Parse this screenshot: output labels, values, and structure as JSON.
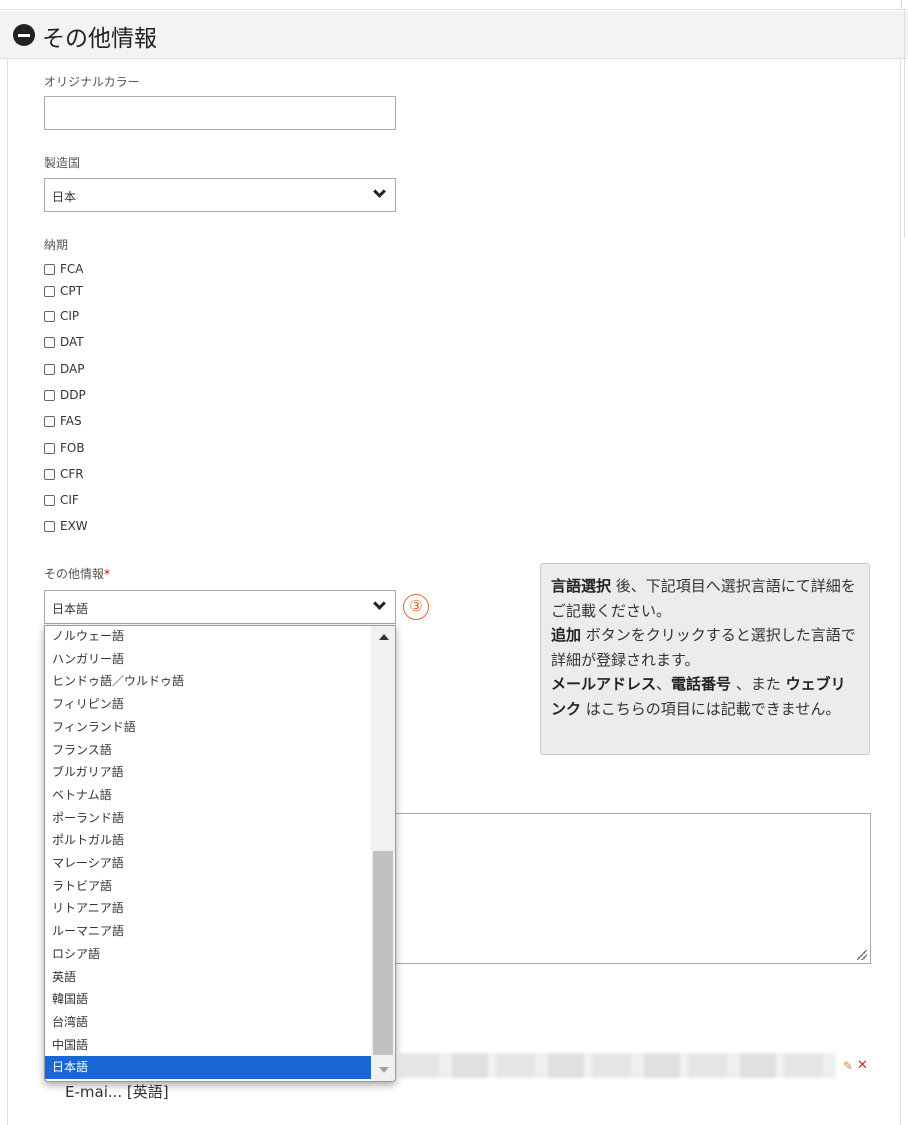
{
  "section": {
    "title": "その他情報"
  },
  "fields": {
    "original_color": {
      "label": "オリジナルカラー",
      "value": ""
    },
    "country": {
      "label": "製造国",
      "value": "日本"
    },
    "delivery": {
      "label": "納期",
      "options": [
        "FCA",
        "CPT",
        "CIP",
        "DAT",
        "DAP",
        "DDP",
        "FAS",
        "FOB",
        "CFR",
        "CIF",
        "EXW"
      ]
    },
    "other_info": {
      "label": "その他情報",
      "required_mark": "*",
      "value": "日本語",
      "annotation": "③"
    }
  },
  "dropdown": {
    "options": [
      "ノルウェー語",
      "ハンガリー語",
      "ヒンドゥ語／ウルドゥ語",
      "フィリピン語",
      "フィンランド語",
      "フランス語",
      "ブルガリア語",
      "ベトナム語",
      "ポーランド語",
      "ポルトガル語",
      "マレーシア語",
      "ラトビア語",
      "リトアニア語",
      "ルーマニア語",
      "ロシア語",
      "英語",
      "韓国語",
      "台湾語",
      "中国語",
      "日本語"
    ],
    "selected": "日本語"
  },
  "info_box": {
    "p1_bold": "言語選択",
    "p1_rest": " 後、下記項目へ選択言語にて詳細をご記載ください。",
    "p2_bold": "追加",
    "p2_rest": " ボタンをクリックすると選択した言語で詳細が登録されます。",
    "p3_bold1": "メールアドレス",
    "p3_sep1": "、",
    "p3_bold2": "電話番号",
    "p3_sep2": " 、また ",
    "p3_bold3": "ウェブリンク",
    "p3_rest": " はこちらの項目には記載できません。"
  },
  "entry": {
    "text": "E-mai... [英語]"
  },
  "icons": {
    "toggle": "minus-circle-icon",
    "edit": "pencil-icon",
    "delete": "close-icon"
  },
  "colors": {
    "selected_option": "#1967d2",
    "annotation": "#e06a2e",
    "required": "#cc0000",
    "delete": "#cc2b1e"
  }
}
